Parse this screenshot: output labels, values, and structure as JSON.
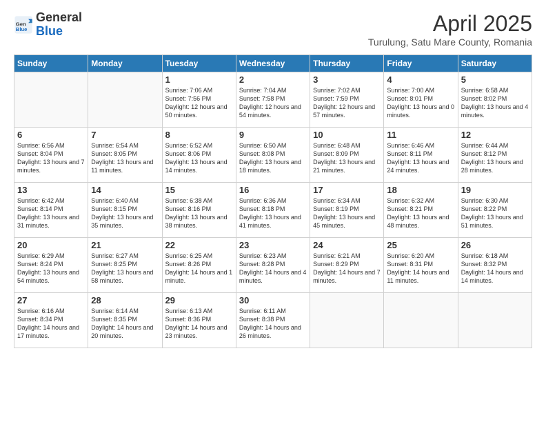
{
  "logo": {
    "general": "General",
    "blue": "Blue"
  },
  "title": {
    "month_year": "April 2025",
    "location": "Turulung, Satu Mare County, Romania"
  },
  "days_of_week": [
    "Sunday",
    "Monday",
    "Tuesday",
    "Wednesday",
    "Thursday",
    "Friday",
    "Saturday"
  ],
  "weeks": [
    [
      {
        "day": "",
        "info": ""
      },
      {
        "day": "",
        "info": ""
      },
      {
        "day": "1",
        "info": "Sunrise: 7:06 AM\nSunset: 7:56 PM\nDaylight: 12 hours and 50 minutes."
      },
      {
        "day": "2",
        "info": "Sunrise: 7:04 AM\nSunset: 7:58 PM\nDaylight: 12 hours and 54 minutes."
      },
      {
        "day": "3",
        "info": "Sunrise: 7:02 AM\nSunset: 7:59 PM\nDaylight: 12 hours and 57 minutes."
      },
      {
        "day": "4",
        "info": "Sunrise: 7:00 AM\nSunset: 8:01 PM\nDaylight: 13 hours and 0 minutes."
      },
      {
        "day": "5",
        "info": "Sunrise: 6:58 AM\nSunset: 8:02 PM\nDaylight: 13 hours and 4 minutes."
      }
    ],
    [
      {
        "day": "6",
        "info": "Sunrise: 6:56 AM\nSunset: 8:04 PM\nDaylight: 13 hours and 7 minutes."
      },
      {
        "day": "7",
        "info": "Sunrise: 6:54 AM\nSunset: 8:05 PM\nDaylight: 13 hours and 11 minutes."
      },
      {
        "day": "8",
        "info": "Sunrise: 6:52 AM\nSunset: 8:06 PM\nDaylight: 13 hours and 14 minutes."
      },
      {
        "day": "9",
        "info": "Sunrise: 6:50 AM\nSunset: 8:08 PM\nDaylight: 13 hours and 18 minutes."
      },
      {
        "day": "10",
        "info": "Sunrise: 6:48 AM\nSunset: 8:09 PM\nDaylight: 13 hours and 21 minutes."
      },
      {
        "day": "11",
        "info": "Sunrise: 6:46 AM\nSunset: 8:11 PM\nDaylight: 13 hours and 24 minutes."
      },
      {
        "day": "12",
        "info": "Sunrise: 6:44 AM\nSunset: 8:12 PM\nDaylight: 13 hours and 28 minutes."
      }
    ],
    [
      {
        "day": "13",
        "info": "Sunrise: 6:42 AM\nSunset: 8:14 PM\nDaylight: 13 hours and 31 minutes."
      },
      {
        "day": "14",
        "info": "Sunrise: 6:40 AM\nSunset: 8:15 PM\nDaylight: 13 hours and 35 minutes."
      },
      {
        "day": "15",
        "info": "Sunrise: 6:38 AM\nSunset: 8:16 PM\nDaylight: 13 hours and 38 minutes."
      },
      {
        "day": "16",
        "info": "Sunrise: 6:36 AM\nSunset: 8:18 PM\nDaylight: 13 hours and 41 minutes."
      },
      {
        "day": "17",
        "info": "Sunrise: 6:34 AM\nSunset: 8:19 PM\nDaylight: 13 hours and 45 minutes."
      },
      {
        "day": "18",
        "info": "Sunrise: 6:32 AM\nSunset: 8:21 PM\nDaylight: 13 hours and 48 minutes."
      },
      {
        "day": "19",
        "info": "Sunrise: 6:30 AM\nSunset: 8:22 PM\nDaylight: 13 hours and 51 minutes."
      }
    ],
    [
      {
        "day": "20",
        "info": "Sunrise: 6:29 AM\nSunset: 8:24 PM\nDaylight: 13 hours and 54 minutes."
      },
      {
        "day": "21",
        "info": "Sunrise: 6:27 AM\nSunset: 8:25 PM\nDaylight: 13 hours and 58 minutes."
      },
      {
        "day": "22",
        "info": "Sunrise: 6:25 AM\nSunset: 8:26 PM\nDaylight: 14 hours and 1 minute."
      },
      {
        "day": "23",
        "info": "Sunrise: 6:23 AM\nSunset: 8:28 PM\nDaylight: 14 hours and 4 minutes."
      },
      {
        "day": "24",
        "info": "Sunrise: 6:21 AM\nSunset: 8:29 PM\nDaylight: 14 hours and 7 minutes."
      },
      {
        "day": "25",
        "info": "Sunrise: 6:20 AM\nSunset: 8:31 PM\nDaylight: 14 hours and 11 minutes."
      },
      {
        "day": "26",
        "info": "Sunrise: 6:18 AM\nSunset: 8:32 PM\nDaylight: 14 hours and 14 minutes."
      }
    ],
    [
      {
        "day": "27",
        "info": "Sunrise: 6:16 AM\nSunset: 8:34 PM\nDaylight: 14 hours and 17 minutes."
      },
      {
        "day": "28",
        "info": "Sunrise: 6:14 AM\nSunset: 8:35 PM\nDaylight: 14 hours and 20 minutes."
      },
      {
        "day": "29",
        "info": "Sunrise: 6:13 AM\nSunset: 8:36 PM\nDaylight: 14 hours and 23 minutes."
      },
      {
        "day": "30",
        "info": "Sunrise: 6:11 AM\nSunset: 8:38 PM\nDaylight: 14 hours and 26 minutes."
      },
      {
        "day": "",
        "info": ""
      },
      {
        "day": "",
        "info": ""
      },
      {
        "day": "",
        "info": ""
      }
    ]
  ]
}
